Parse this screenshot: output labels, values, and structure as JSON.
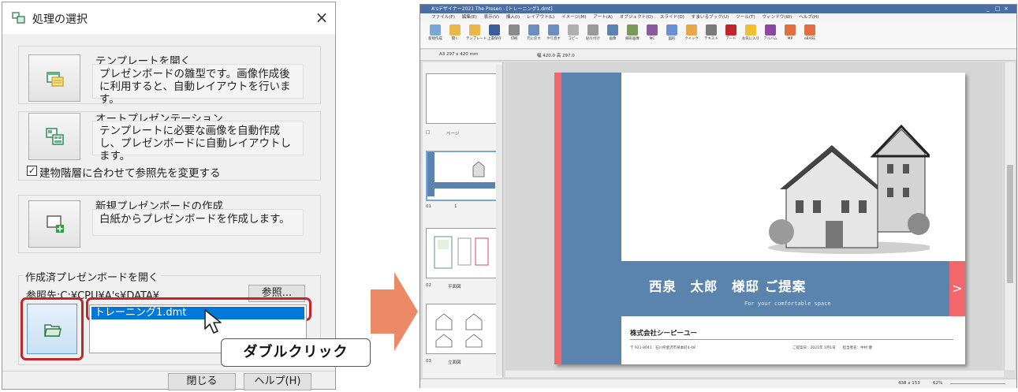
{
  "dialog": {
    "title": "処理の選択",
    "close_glyph": "×",
    "options": [
      {
        "name": "テンプレートを開く",
        "desc": "プレゼンボードの雛型です。画像作成後に利用すると、自動レイアウトを行います。",
        "icon": "template-icon"
      },
      {
        "name": "オートプレゼンテーション",
        "desc": "テンプレートに必要な画像を自動作成し、プレゼンボードに自動レイアウトします。",
        "icon": "auto-presentation-icon"
      },
      {
        "name": "新規プレゼンボードの作成",
        "desc": "白紙からプレゼンボードを作成します。",
        "icon": "new-board-icon"
      }
    ],
    "checkbox_label": "建物階層に合わせて参照先を変更する",
    "checkbox_checked": true,
    "open_group_label": "作成済プレゼンボードを開く",
    "ref_path_label": "参照先:C:¥CPU¥A's¥DATA¥",
    "browse_label": "参照...",
    "files": [
      "トレーニング1.dmt"
    ],
    "selected_file": "トレーニング1.dmt",
    "callout": "ダブルクリック",
    "close_button": "閉じる",
    "help_button": "ヘルプ(H)",
    "highlight_color": "#c0272d"
  },
  "arrow_color": "#ec8a68",
  "app": {
    "title": "A'sデザイナー2021 The Presen - [トレーニング1.dmt]",
    "window_controls": [
      "_",
      "□",
      "×"
    ],
    "menu": [
      "ファイル(F)",
      "編集(E)",
      "表示(V)",
      "挿入(I)",
      "レイアウト(L)",
      "イメージ(M)",
      "アート(A)",
      "オブジェクト(O)",
      "スライド(D)",
      "すまいるブック(U)",
      "ツール(T)",
      "ウィンドウ(W)",
      "ヘルプ(H)"
    ],
    "toolbar": [
      {
        "label": "新規作成",
        "icon": "new-file-icon",
        "color": "#7aa7d8"
      },
      {
        "label": "開く",
        "icon": "open-folder-icon",
        "color": "#e8b84a"
      },
      {
        "label": "テンプレート",
        "icon": "template-icon",
        "color": "#e8b84a"
      },
      {
        "label": "上書保存",
        "icon": "save-icon",
        "color": "#3a5f9a"
      },
      {
        "label": "印刷",
        "icon": "print-icon",
        "color": "#8a8a8a"
      },
      {
        "label": "元に戻す",
        "icon": "undo-icon",
        "color": "#6c8fbf"
      },
      {
        "label": "やり直す",
        "icon": "redo-icon",
        "color": "#6c8fbf"
      },
      {
        "label": "コピー",
        "icon": "copy-icon",
        "color": "#b0b0b0"
      },
      {
        "label": "貼り付け",
        "icon": "paste-icon",
        "color": "#9a9a9a"
      },
      {
        "label": "画像",
        "icon": "image-icon",
        "color": "#5a83ad"
      },
      {
        "label": "線形画像",
        "icon": "line-image-icon",
        "color": "#7a9a5a"
      },
      {
        "label": "MC",
        "icon": "mc-icon",
        "color": "#8a5a9a"
      },
      {
        "label": "図形",
        "icon": "shape-icon",
        "color": "#6b8fd6"
      },
      {
        "label": "クイック",
        "icon": "quick-icon",
        "color": "#e8a84a"
      },
      {
        "label": "テキスト",
        "icon": "text-icon",
        "color": "#7a7a7a"
      },
      {
        "label": "アート",
        "icon": "art-icon",
        "color": "#c0272d"
      },
      {
        "label": "お気に入り",
        "icon": "favorite-star-icon",
        "color": "#f0c030"
      },
      {
        "label": "アルバム",
        "icon": "album-icon",
        "color": "#8a4aa0"
      },
      {
        "label": "MP",
        "icon": "mp-icon",
        "color": "#e07040"
      },
      {
        "label": "eBASE",
        "icon": "ebase-icon",
        "color": "#e07040"
      }
    ],
    "paper_size": "A3 297 x 420 mm",
    "paper_dims": "幅 420.0  高 297.0",
    "thumbnails": [
      {
        "label": "",
        "name": ""
      },
      {
        "label": "ページ",
        "name": ""
      },
      {
        "label": "01",
        "name": "1"
      },
      {
        "label": "02",
        "name": "平面図"
      },
      {
        "label": "03",
        "name": "立面図"
      }
    ],
    "status_dims": "438 x 153",
    "status_zoom": "62%"
  },
  "board": {
    "title": "西泉　太郎　様邸 ご提案",
    "tagline": "For your comfortable space",
    "company": "株式会社シーピーユー",
    "address": "〒 921-8041　石川県金沢市泉本町4-48",
    "date": "ご提案日：2021年 1月1日　　担当者名：中村 健",
    "arrow_glyph": ">",
    "bar_color": "#5a83ad",
    "stripe_color": "#f2676b"
  }
}
